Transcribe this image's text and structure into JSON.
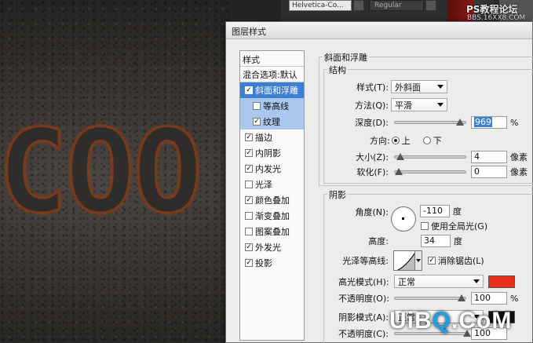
{
  "topbar": {
    "font_family": "Helvetica-Co...",
    "font_style": "Regular",
    "watermark_line1": "PS教程论坛",
    "watermark_line2": "BBS.16XX8.COM"
  },
  "canvas": {
    "text": "COO",
    "glow_color": "#a4420e"
  },
  "dialog": {
    "title": "图层样式",
    "styles_header": "样式",
    "blend_options": "混合选项:默认",
    "items": [
      {
        "label": "斜面和浮雕",
        "checked": true
      },
      {
        "label": "等高线",
        "checked": false
      },
      {
        "label": "纹理",
        "checked": true
      },
      {
        "label": "描边",
        "checked": true
      },
      {
        "label": "内阴影",
        "checked": true
      },
      {
        "label": "内发光",
        "checked": true
      },
      {
        "label": "光泽",
        "checked": false
      },
      {
        "label": "颜色叠加",
        "checked": true
      },
      {
        "label": "渐变叠加",
        "checked": false
      },
      {
        "label": "图案叠加",
        "checked": false
      },
      {
        "label": "外发光",
        "checked": true
      },
      {
        "label": "投影",
        "checked": true
      }
    ],
    "bevel": {
      "section_title": "斜面和浮雕",
      "structure_title": "结构",
      "style_label": "样式(T):",
      "style_value": "外斜面",
      "technique_label": "方法(Q):",
      "technique_value": "平滑",
      "depth_label": "深度(D):",
      "depth_value": "969",
      "depth_unit": "%",
      "depth_level": 0.97,
      "direction_label": "方向:",
      "dir_up": "上",
      "dir_down": "下",
      "size_label": "大小(Z):",
      "size_value": "4",
      "size_unit": "像素",
      "size_level": 0.02,
      "soften_label": "软化(F):",
      "soften_value": "0",
      "soften_unit": "像素",
      "soften_level": 0.0
    },
    "shading": {
      "title": "阴影",
      "angle_label": "角度(N):",
      "angle_value": "-110",
      "angle_unit": "度",
      "global_light_label": "使用全局光(G)",
      "altitude_label": "高度:",
      "altitude_value": "34",
      "altitude_unit": "度",
      "gloss_label": "光泽等高线:",
      "antialias_label": "消除锯齿(L)",
      "highlight_label": "高光模式(H):",
      "highlight_value": "正常",
      "highlight_color": "#e83018",
      "opacity1_label": "不透明度(O):",
      "opacity1_value": "100",
      "opacity1_unit": "%",
      "opacity1_level": 1.0,
      "shadow_label": "阴影模式(A):",
      "shadow_value": "正常",
      "shadow_color": "#111111",
      "opacity2_label": "不透明度(C):",
      "opacity2_value": "100"
    }
  },
  "watermark": {
    "prefix": "UiB",
    "q": "Q",
    "suffix": ".CoM"
  }
}
